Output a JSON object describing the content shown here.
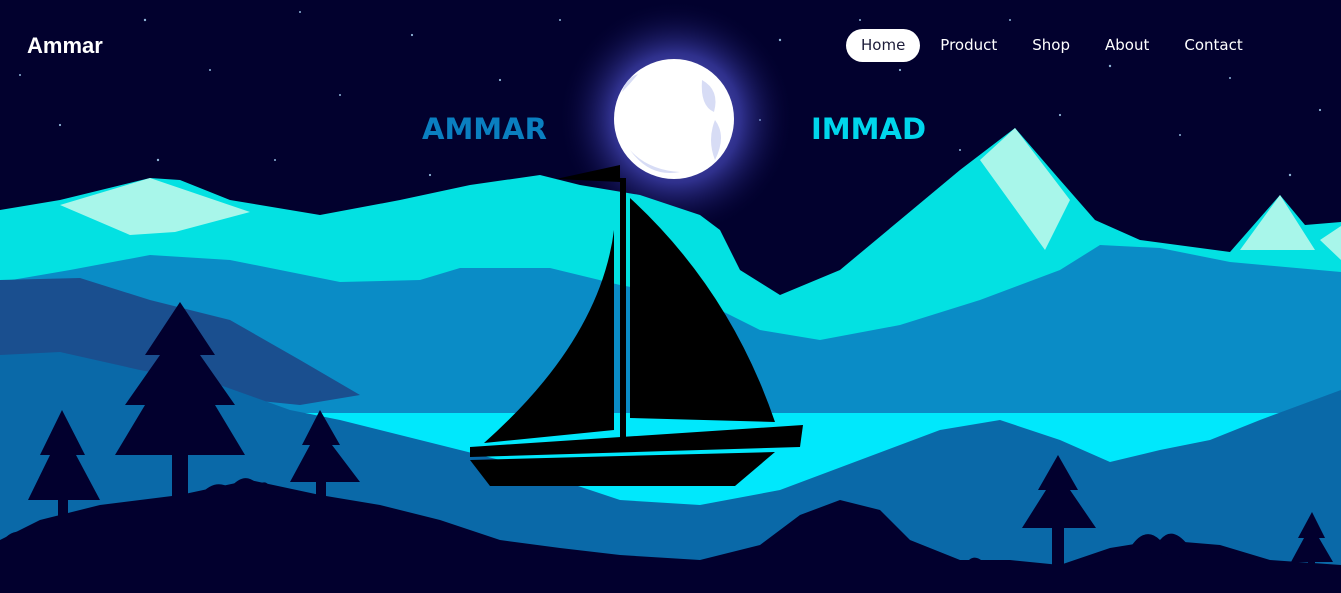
{
  "brand": {
    "name": "Ammar"
  },
  "nav": {
    "items": [
      {
        "label": "Home",
        "active": true
      },
      {
        "label": "Product",
        "active": false
      },
      {
        "label": "Shop",
        "active": false
      },
      {
        "label": "About",
        "active": false
      },
      {
        "label": "Contact",
        "active": false
      }
    ]
  },
  "hero": {
    "first_word": "AMMAR",
    "second_word": "IMMAD"
  },
  "colors": {
    "sky": "#02012e",
    "mountain_light": "#03e1e2",
    "mountain_mid": "#0a8cc6",
    "lake": "#00e8fc",
    "hill": "#0a69a8",
    "foreground": "#02002e",
    "moon": "#ffffff"
  }
}
